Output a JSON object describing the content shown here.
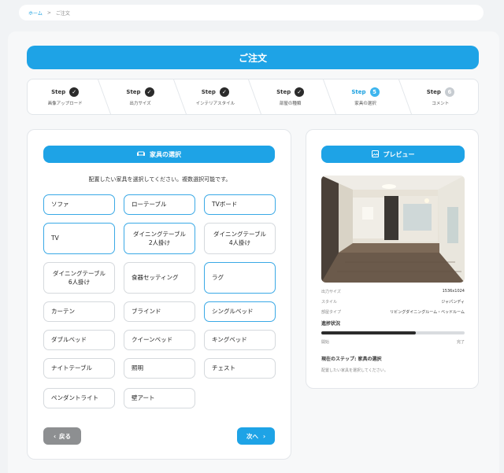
{
  "breadcrumb": {
    "home": "ホーム",
    "separator": ">",
    "current": "ご注文"
  },
  "title": "ご注文",
  "steps": [
    {
      "label": "Step",
      "status": "done",
      "mark": "✓",
      "name": "画像アップロード"
    },
    {
      "label": "Step",
      "status": "done",
      "mark": "✓",
      "name": "出力サイズ"
    },
    {
      "label": "Step",
      "status": "done",
      "mark": "✓",
      "name": "インテリアスタイル"
    },
    {
      "label": "Step",
      "status": "done",
      "mark": "✓",
      "name": "部屋の種類"
    },
    {
      "label": "Step",
      "status": "active",
      "mark": "5",
      "name": "家具の選択"
    },
    {
      "label": "Step",
      "status": "pending",
      "mark": "6",
      "name": "コメント"
    }
  ],
  "furniture": {
    "header": "家具の選択",
    "header_icon": "sofa-icon",
    "instruction": "配置したい家具を選択してください。複数選択可能です。",
    "options": [
      {
        "label": "ソファ",
        "selected": true
      },
      {
        "label": "ローテーブル",
        "selected": true
      },
      {
        "label": "TVボード",
        "selected": true
      },
      {
        "label": "TV",
        "selected": true
      },
      {
        "label": "ダイニングテーブル\n2人掛け",
        "selected": true
      },
      {
        "label": "ダイニングテーブル\n4人掛け",
        "selected": false
      },
      {
        "label": "ダイニングテーブル\n6人掛け",
        "selected": false
      },
      {
        "label": "食器セッティング",
        "selected": false
      },
      {
        "label": "ラグ",
        "selected": true
      },
      {
        "label": "カーテン",
        "selected": false
      },
      {
        "label": "ブラインド",
        "selected": false
      },
      {
        "label": "シングルベッド",
        "selected": true
      },
      {
        "label": "ダブルベッド",
        "selected": false
      },
      {
        "label": "クイーンベッド",
        "selected": false
      },
      {
        "label": "キングベッド",
        "selected": false
      },
      {
        "label": "ナイトテーブル",
        "selected": false
      },
      {
        "label": "照明",
        "selected": false
      },
      {
        "label": "チェスト",
        "selected": false
      },
      {
        "label": "ペンダントライト",
        "selected": false
      },
      {
        "label": "壁アート",
        "selected": false
      }
    ],
    "back_label": "戻る",
    "next_label": "次へ"
  },
  "preview": {
    "header": "プレビュー",
    "header_icon": "image-icon",
    "info": [
      {
        "key": "出力サイズ",
        "value": "1536x1024"
      },
      {
        "key": "スタイル",
        "value": "ジャパンディ"
      },
      {
        "key": "部屋タイプ",
        "value": "リビングダイニングルーム・ベッドルーム"
      }
    ],
    "progress_title": "進捗状況",
    "progress_fraction": 0.66,
    "progress_start": "開始",
    "progress_end": "完了",
    "current_step": "現在のステップ: 家具の選択",
    "current_desc": "配置したい家具を選択してください。"
  },
  "colors": {
    "accent": "#1ea3e6",
    "back_button": "#8d8f91",
    "done_step": "#2b2b2b"
  }
}
